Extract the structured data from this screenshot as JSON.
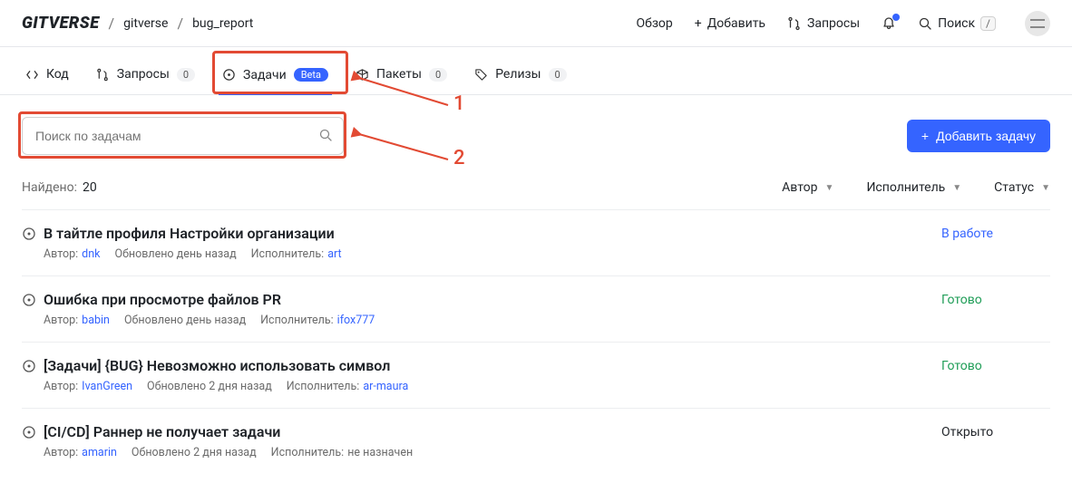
{
  "header": {
    "logo": "GITVERSE",
    "breadcrumb_owner": "gitverse",
    "breadcrumb_repo": "bug_report",
    "nav": {
      "overview": "Обзор",
      "add": "Добавить",
      "requests": "Запросы",
      "search": "Поиск",
      "search_kbd": "/"
    }
  },
  "tabs": {
    "code": "Код",
    "requests": "Запросы",
    "requests_count": "0",
    "issues": "Задачи",
    "issues_badge": "Beta",
    "packages": "Пакеты",
    "packages_count": "0",
    "releases": "Релизы",
    "releases_count": "0"
  },
  "annotations": {
    "one": "1",
    "two": "2"
  },
  "search": {
    "placeholder": "Поиск по задачам",
    "add_button": "Добавить задачу"
  },
  "list": {
    "found_label": "Найдено:",
    "found_count": "20",
    "filters": {
      "author": "Автор",
      "assignee": "Исполнитель",
      "status": "Статус"
    },
    "meta_labels": {
      "author": "Автор:",
      "assignee": "Исполнитель:"
    },
    "items": [
      {
        "title": "В тайтле профиля Настройки организации",
        "author": "dnk",
        "updated": "Обновлено день назад",
        "assignee": "art",
        "assignee_unassigned": false,
        "status": "В работе",
        "status_class": "st-work"
      },
      {
        "title": "Ошибка при просмотре файлов PR",
        "author": "babin",
        "updated": "Обновлено день назад",
        "assignee": "ifox777",
        "assignee_unassigned": false,
        "status": "Готово",
        "status_class": "st-done"
      },
      {
        "title": "[Задачи] {BUG} Невозможно использовать символ",
        "author": "IvanGreen",
        "updated": "Обновлено 2 дня назад",
        "assignee": "ar-maura",
        "assignee_unassigned": false,
        "status": "Готово",
        "status_class": "st-done"
      },
      {
        "title": "[CI/CD] Раннер не получает задачи",
        "author": "amarin",
        "updated": "Обновлено 2 дня назад",
        "assignee": "не назначен",
        "assignee_unassigned": true,
        "status": "Открыто",
        "status_class": "st-open"
      }
    ]
  }
}
